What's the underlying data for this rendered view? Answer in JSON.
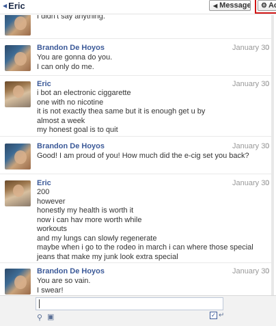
{
  "header": {
    "title": "Eric",
    "messages_button": "Messages",
    "actions_button": "Ac"
  },
  "messages": [
    {
      "sender": "",
      "date": "",
      "avatar": "brandon",
      "lines": [
        "I didn't say anything."
      ]
    },
    {
      "sender": "Brandon De Hoyos",
      "date": "January 30",
      "avatar": "brandon",
      "lines": [
        "You are gonna do you.",
        "I can only do me."
      ]
    },
    {
      "sender": "Eric",
      "date": "January 30",
      "avatar": "eric",
      "lines": [
        "i bot an electronic ciggarette",
        "one with no nicotine",
        "it is not exactly thea same but it is enough get u by",
        "almost a week",
        "my honest goal is to quit"
      ]
    },
    {
      "sender": "Brandon De Hoyos",
      "date": "January 30",
      "avatar": "brandon",
      "lines": [
        "Good! I am proud of you! How much did the e-cig set you back?"
      ]
    },
    {
      "sender": "Eric",
      "date": "January 30",
      "avatar": "eric",
      "lines": [
        "200",
        "however",
        "honestly my health is worth it",
        "now i can hav more worth while",
        "workouts",
        "and my lungs can slowly regenerate",
        "maybe when i go to the rodeo in march i can where those special",
        "jeans that make my junk look extra special"
      ]
    },
    {
      "sender": "Brandon De Hoyos",
      "date": "January 30",
      "avatar": "brandon",
      "lines": [
        "You are so vain.",
        "I swear!"
      ]
    }
  ],
  "composer": {
    "value": ""
  },
  "icons": {
    "back": "left-arrow-icon",
    "messages_arrow": "left-triangle-icon",
    "actions": "gear-icon",
    "comment": "comment-bubble-icon",
    "attach": "paperclip-icon",
    "camera": "camera-icon",
    "enter": "return-icon"
  }
}
